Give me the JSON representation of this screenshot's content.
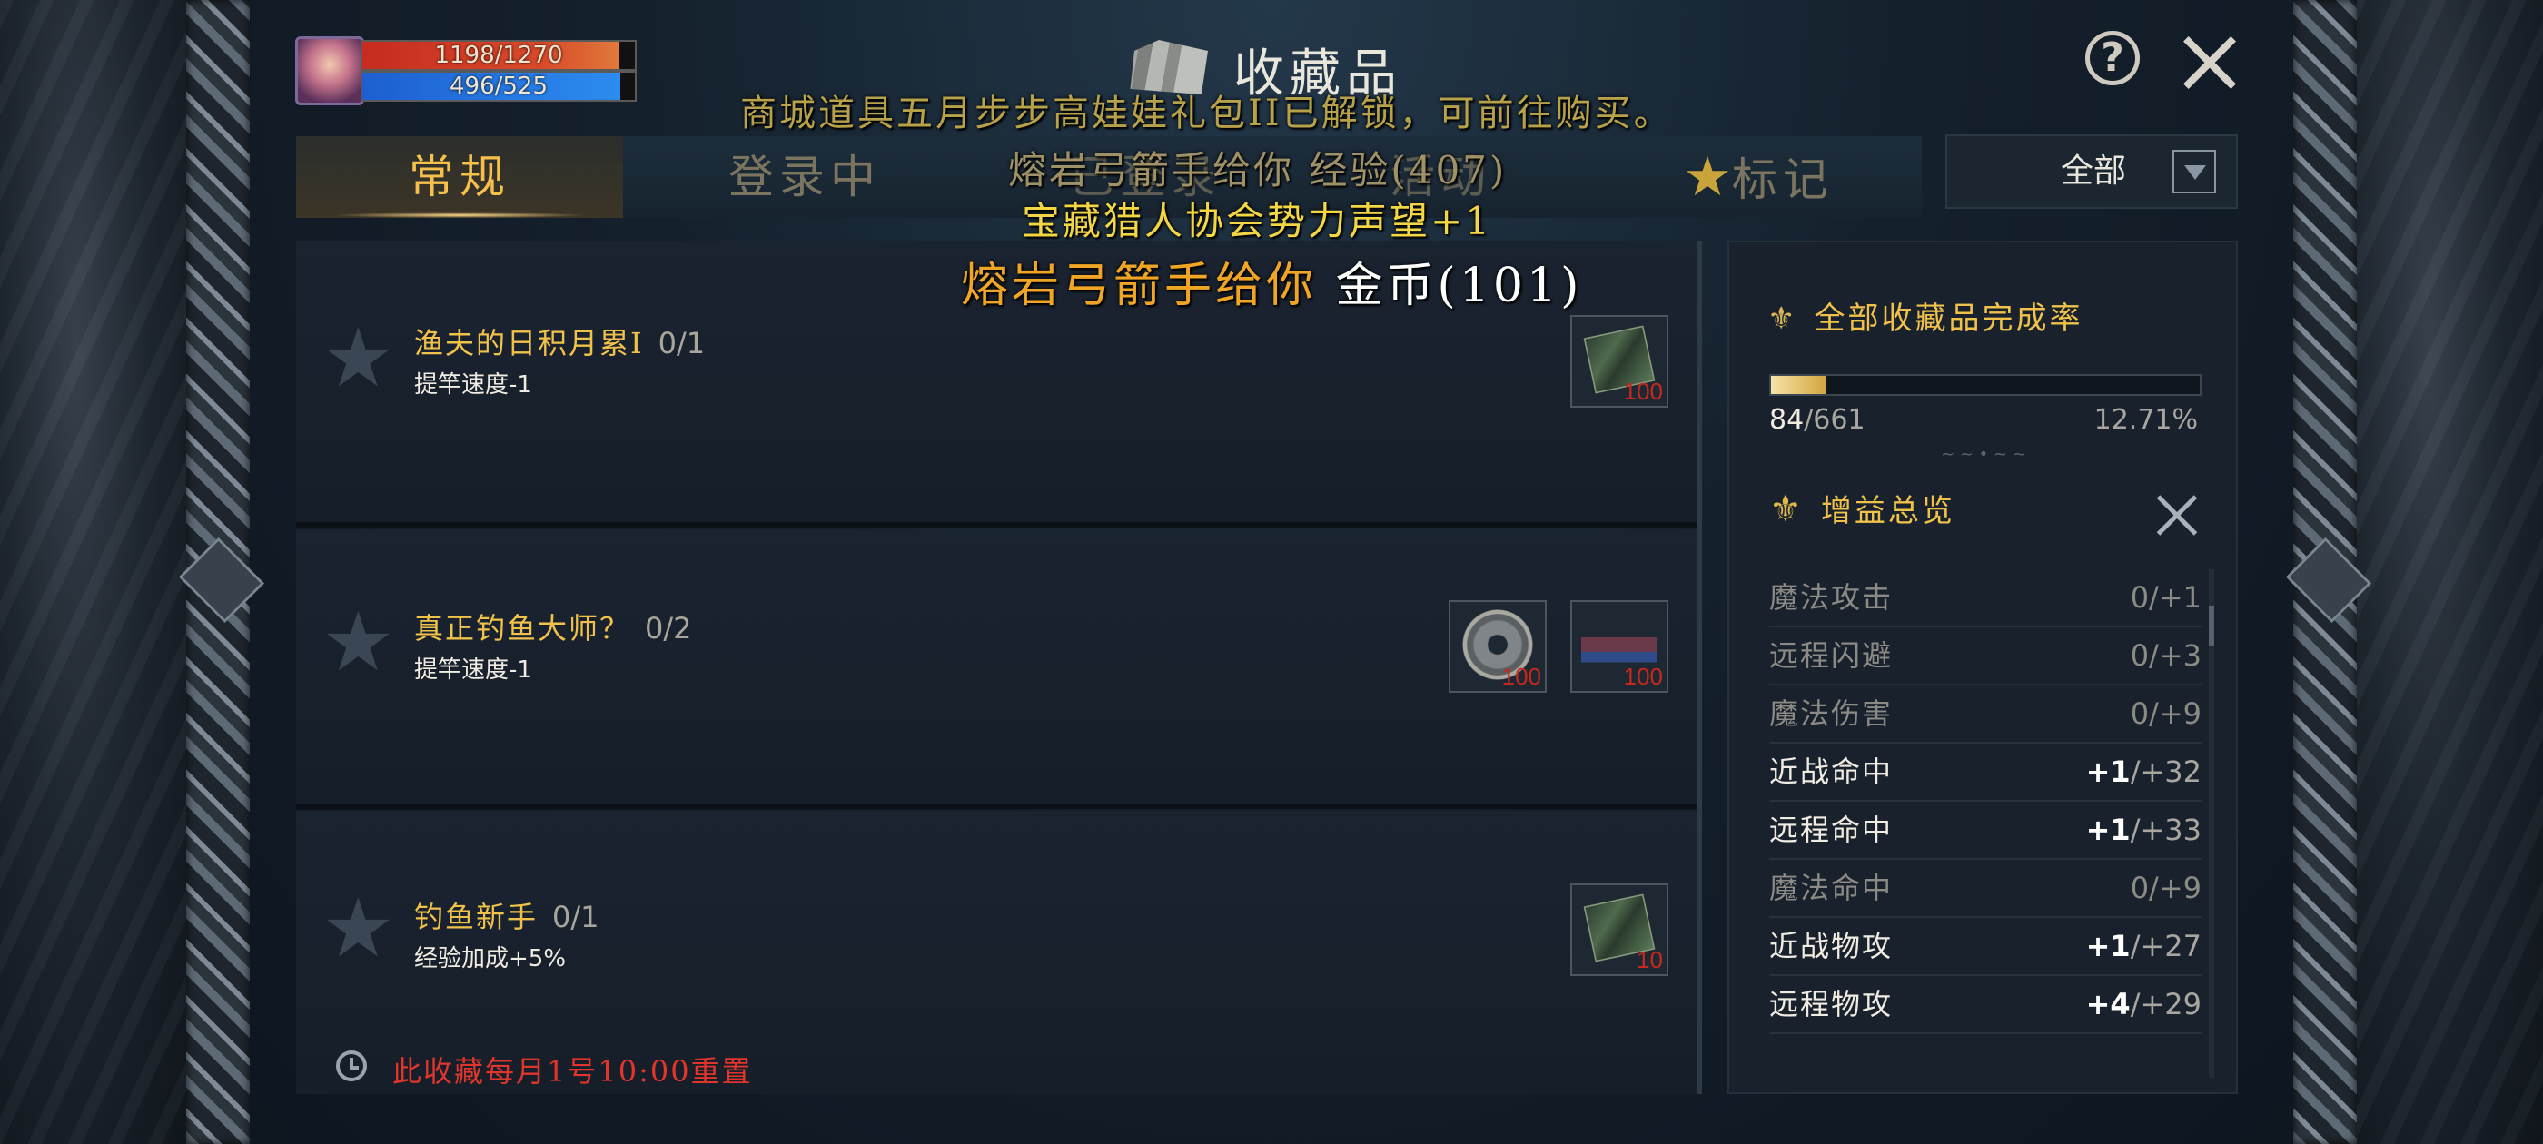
{
  "hud": {
    "hp_text": "1198/1270",
    "hp_fraction": 0.943,
    "mp_text": "496/525",
    "mp_fraction": 0.945
  },
  "window": {
    "title": "收藏品",
    "help_icon": "question-circle-icon",
    "close_icon": "close-x-icon"
  },
  "notices": {
    "line1": "商城道具五月步步高娃娃礼包II已解锁，可前往购买。",
    "line2": "熔岩弓箭手给你 经验(407)",
    "line3": "宝藏猎人协会势力声望+1",
    "line4_prefix": "熔岩弓箭手给你",
    "line4_value": "金币(101)"
  },
  "tabs": [
    {
      "label": "常规",
      "active": true
    },
    {
      "label": "登录中",
      "active": false
    },
    {
      "label": "已登录",
      "active": false
    },
    {
      "label": "活动",
      "active": false
    },
    {
      "label": "标记",
      "active": false,
      "icon": "star-icon"
    }
  ],
  "filter": {
    "value": "全部",
    "icon": "chevron-down-icon"
  },
  "collections": [
    {
      "name": "渔夫的日积月累I",
      "progress": "0/1",
      "effect": "提竿速度-1",
      "rewards": [
        {
          "icon": "fish-card-icon",
          "qty": "100"
        }
      ]
    },
    {
      "name": "真正钓鱼大师？",
      "progress": "0/2",
      "effect": "提竿速度-1",
      "rewards": [
        {
          "icon": "rope-coil-icon",
          "qty": "100"
        },
        {
          "icon": "boat-icon",
          "qty": "100"
        }
      ]
    },
    {
      "name": "钓鱼新手",
      "progress": "0/1",
      "effect": "经验加成+5%",
      "rewards": [
        {
          "icon": "fish-card-icon",
          "qty": "10"
        }
      ]
    }
  ],
  "reset_note": "此收藏每月1号10:00重置",
  "completion": {
    "title": "全部收藏品完成率",
    "icon": "fleur-sword-icon",
    "current": "84",
    "total": "/661",
    "percent": "12.71%",
    "fraction": 0.1271
  },
  "buffs": {
    "title": "增益总览",
    "icon": "fleur-de-lis-icon",
    "items": [
      {
        "name": "魔法攻击",
        "current": "0",
        "max": "/+1",
        "active": false
      },
      {
        "name": "远程闪避",
        "current": "0",
        "max": "/+3",
        "active": false
      },
      {
        "name": "魔法伤害",
        "current": "0",
        "max": "/+9",
        "active": false
      },
      {
        "name": "近战命中",
        "current": "+1",
        "max": "/+32",
        "active": true
      },
      {
        "name": "远程命中",
        "current": "+1",
        "max": "/+33",
        "active": true
      },
      {
        "name": "魔法命中",
        "current": "0",
        "max": "/+9",
        "active": false
      },
      {
        "name": "近战物攻",
        "current": "+1",
        "max": "/+27",
        "active": true
      },
      {
        "name": "远程物攻",
        "current": "+4",
        "max": "/+29",
        "active": true
      }
    ]
  }
}
